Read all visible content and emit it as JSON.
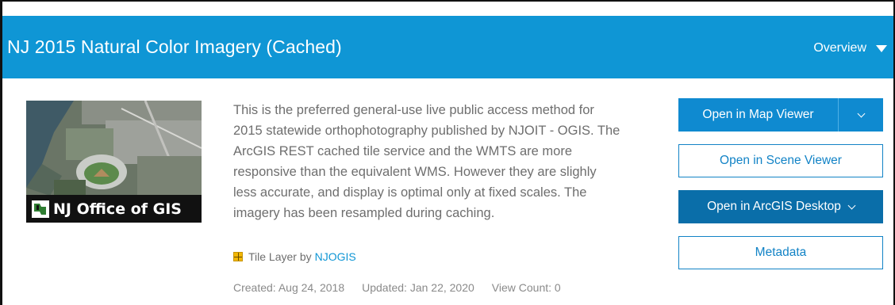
{
  "header": {
    "title": "NJ 2015 Natural Color Imagery (Cached)",
    "overview_label": "Overview"
  },
  "thumbnail": {
    "caption": "NJ Office of GIS"
  },
  "description": "This is the preferred general-use live public access method for 2015 statewide orthophotography published by NJOIT - OGIS. The ArcGIS REST cached tile service and the WMTS are more responsive than the equivalent WMS. However they are slighly less accurate, and display is optimal only at fixed scales. The imagery has been resampled during caching.",
  "item_type": {
    "icon": "tile-layer-icon",
    "prefix": "Tile Layer by",
    "owner": "NJOGIS"
  },
  "dates": {
    "created": "Created: Aug 24, 2018",
    "updated": "Updated: Jan 22, 2020",
    "view_count": "View Count: 0"
  },
  "actions": {
    "open_map_viewer": "Open in Map Viewer",
    "open_scene_viewer": "Open in Scene Viewer",
    "open_arcgis_desktop": "Open in ArcGIS Desktop",
    "metadata": "Metadata"
  },
  "colors": {
    "header_bg": "#0f96d5",
    "primary_button": "#0f8ad0",
    "dark_button": "#0a6ea9",
    "link": "#0f96d5"
  }
}
